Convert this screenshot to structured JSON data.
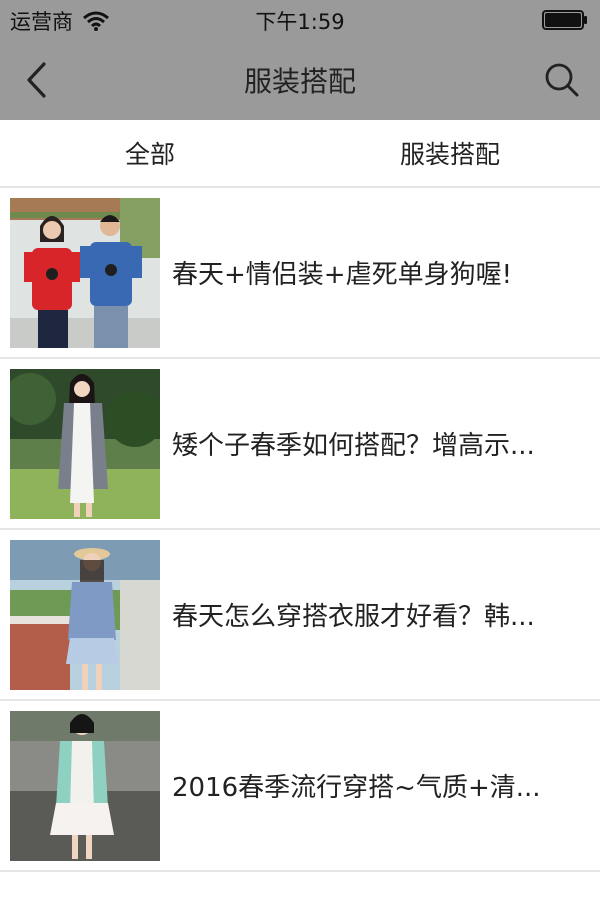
{
  "status_bar": {
    "carrier": "运营商",
    "time": "下午1:59"
  },
  "nav": {
    "title": "服装搭配"
  },
  "tabs": [
    {
      "label": "全部"
    },
    {
      "label": "服装搭配"
    }
  ],
  "items": [
    {
      "title": "春天+情侣装+虐死单身狗喔!",
      "image": "couple-red-blue-tshirts"
    },
    {
      "title": "矮个子春季如何搭配？增高示...",
      "image": "girl-grey-cardigan-park"
    },
    {
      "title": "春天怎么穿搭衣服才好看？韩...",
      "image": "girl-hat-blue-dress"
    },
    {
      "title": "2016春季流行穿搭~气质+清...",
      "image": "girl-mint-cardigan-dress"
    }
  ],
  "colors": {
    "header_bg": "#9a9a9a",
    "divider": "#e6e6e6"
  }
}
